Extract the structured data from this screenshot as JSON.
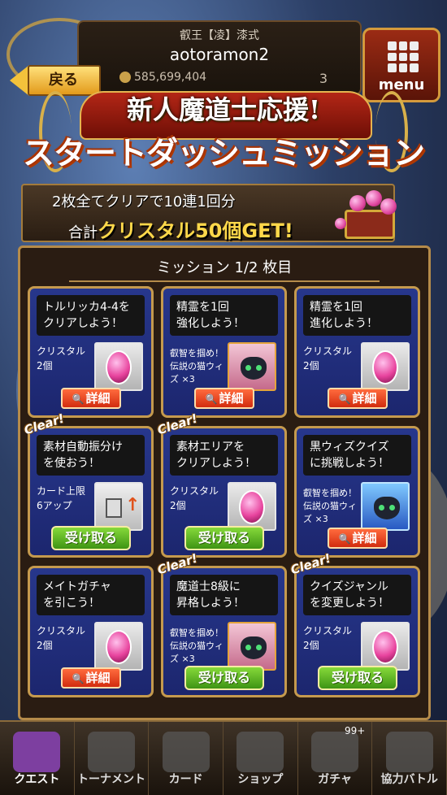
{
  "header": {
    "back_label": "戻る",
    "player_title": "叡王【凌】漆式",
    "player_name": "aotoramon2",
    "coins": "585,699,404",
    "gems": "3",
    "menu_label": "menu"
  },
  "banner": {
    "subtitle": "新人魔道士応援!",
    "title": "スタートダッシュミッション"
  },
  "reward_strip": {
    "line1": "2枚全てクリアで10連1回分",
    "line2_prefix": "合計",
    "line2_main": "クリスタル50個GET!"
  },
  "panel": {
    "title": "ミッション 1/2 枚目"
  },
  "missions": [
    {
      "quest": "トルリッカ4-4を\nクリアしよう！",
      "reward": "クリスタル\n2個",
      "thumb": "crystal-icon",
      "button": "詳細",
      "cleared": false
    },
    {
      "quest": "精霊を1回\n強化しよう！",
      "reward": "叡智を掴め！\n伝説の猫ウィ\nズ ×3",
      "thumb": "wiz-cat-icon",
      "button": "詳細",
      "cleared": false
    },
    {
      "quest": "精霊を1回\n進化しよう！",
      "reward": "クリスタル\n2個",
      "thumb": "crystal-icon",
      "button": "詳細",
      "cleared": false
    },
    {
      "quest": "素材自動振分け\nを使おう！",
      "reward": "カード上限\n6アップ",
      "thumb": "card-limit-icon",
      "button": "受け取る",
      "cleared": true
    },
    {
      "quest": "素材エリアを\nクリアしよう！",
      "reward": "クリスタル\n2個",
      "thumb": "crystal-icon",
      "button": "受け取る",
      "cleared": true
    },
    {
      "quest": "黒ウィズクイズ\nに挑戦しよう！",
      "reward": "叡智を掴め！\n伝説の猫ウィ\nズ ×3",
      "thumb": "wiz-cat-icon",
      "button": "詳細",
      "cleared": false
    },
    {
      "quest": "メイトガチャ\nを引こう！",
      "reward": "クリスタル\n2個",
      "thumb": "crystal-icon",
      "button": "詳細",
      "cleared": false
    },
    {
      "quest": "魔道士8級に\n昇格しよう！",
      "reward": "叡智を掴め！\n伝説の猫ウィ\nズ ×3",
      "thumb": "wiz-cat-icon",
      "button": "受け取る",
      "cleared": true
    },
    {
      "quest": "クイズジャンル\nを変更しよう！",
      "reward": "クリスタル\n2個",
      "thumb": "crystal-icon",
      "button": "受け取る",
      "cleared": true
    }
  ],
  "clear_tag": "Clear!",
  "bottom_nav": [
    {
      "label": "クエスト",
      "icon": "quest-icon",
      "active": true
    },
    {
      "label": "トーナメント",
      "icon": "tournament-icon",
      "active": false
    },
    {
      "label": "カード",
      "icon": "card-icon",
      "active": false
    },
    {
      "label": "ショップ",
      "icon": "shop-icon",
      "active": false
    },
    {
      "label": "ガチャ",
      "icon": "gacha-icon",
      "active": false,
      "badge": "99+"
    },
    {
      "label": "協力バトル",
      "icon": "coop-battle-icon",
      "active": false
    }
  ]
}
